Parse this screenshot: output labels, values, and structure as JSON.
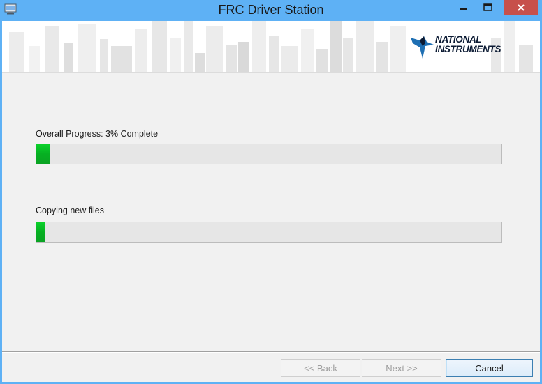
{
  "window": {
    "title": "FRC Driver Station",
    "icon": "installer-computer-icon",
    "controls": [
      "minimize-icon",
      "maximize-icon",
      "close-icon"
    ],
    "title_bar_color": "#5eb1f5",
    "close_color": "#c7504b"
  },
  "banner": {
    "logo_line1": "NATIONAL",
    "logo_line2": "INSTRUMENTS",
    "logo_icon": "eagle-icon"
  },
  "progress": {
    "overall_label": "Overall Progress: 3% Complete",
    "overall_value": 0.03,
    "task_label": "Copying new files",
    "task_value": 0.02,
    "fill_color": "#06b022"
  },
  "footer": {
    "back_label": "<< Back",
    "next_label": "Next >>",
    "cancel_label": "Cancel"
  }
}
